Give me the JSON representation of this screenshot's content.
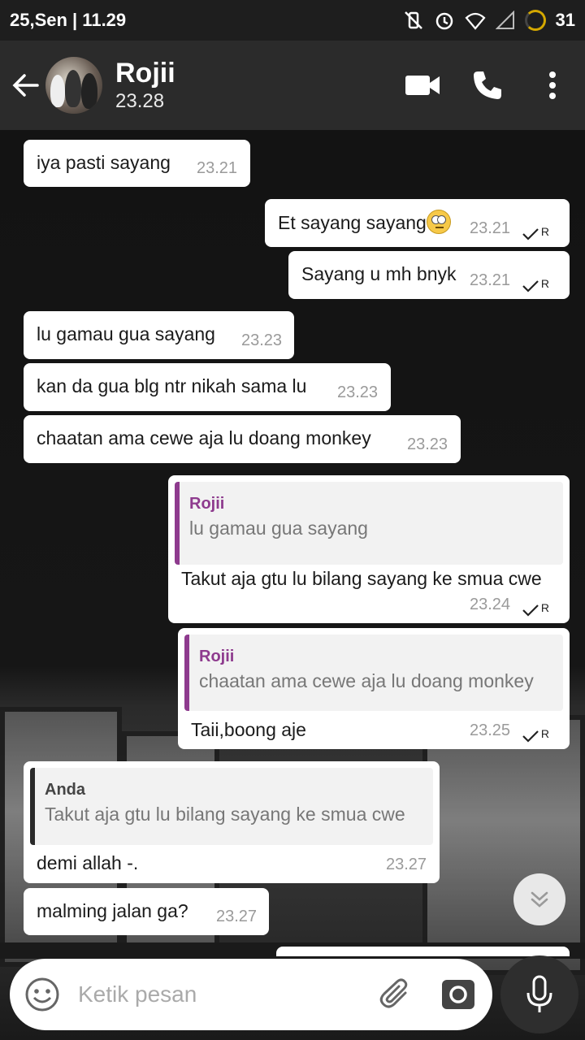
{
  "status_bar": {
    "date_time": "25,Sen | 11.29",
    "battery": "31"
  },
  "header": {
    "contact_name": "Rojii",
    "subtitle": "23.28"
  },
  "messages": [
    {
      "text": "iya pasti sayang",
      "time": "23.21"
    },
    {
      "text": "Et sayang sayang",
      "time": "23.21",
      "tick": "R"
    },
    {
      "text": "Sayang u mh bnyk",
      "time": "23.21",
      "tick": "R"
    },
    {
      "text": "lu gamau gua sayang",
      "time": "23.23"
    },
    {
      "text": "kan da gua blg ntr nikah sama lu",
      "time": "23.23"
    },
    {
      "text": "chaatan ama cewe aja lu doang monkey",
      "time": "23.23"
    },
    {
      "quote_name": "Rojii",
      "quote_text": "lu gamau gua sayang",
      "text": "Takut aja gtu lu bilang sayang ke smua cwe",
      "time": "23.24",
      "tick": "R"
    },
    {
      "quote_name": "Rojii",
      "quote_text": "chaatan ama cewe aja lu doang monkey",
      "text": "Taii,boong aje",
      "time": "23.25",
      "tick": "R"
    },
    {
      "quote_name": "Anda",
      "quote_text": "Takut aja gtu lu bilang sayang ke smua cwe",
      "text": "demi allah -.",
      "time": "23.27"
    },
    {
      "text": "malming jalan ga?",
      "time": "23.27"
    }
  ],
  "input": {
    "placeholder": "Ketik pesan"
  },
  "colors": {
    "quote_contact": "#8e3b8e",
    "quote_self": "#2a2a2a",
    "header_bg": "#2b2b2b"
  },
  "icons": [
    "back-arrow-icon",
    "video-call-icon",
    "phone-icon",
    "more-vert-icon",
    "emoji-icon",
    "attach-icon",
    "camera-icon",
    "mic-icon",
    "chevron-double-down-icon"
  ]
}
